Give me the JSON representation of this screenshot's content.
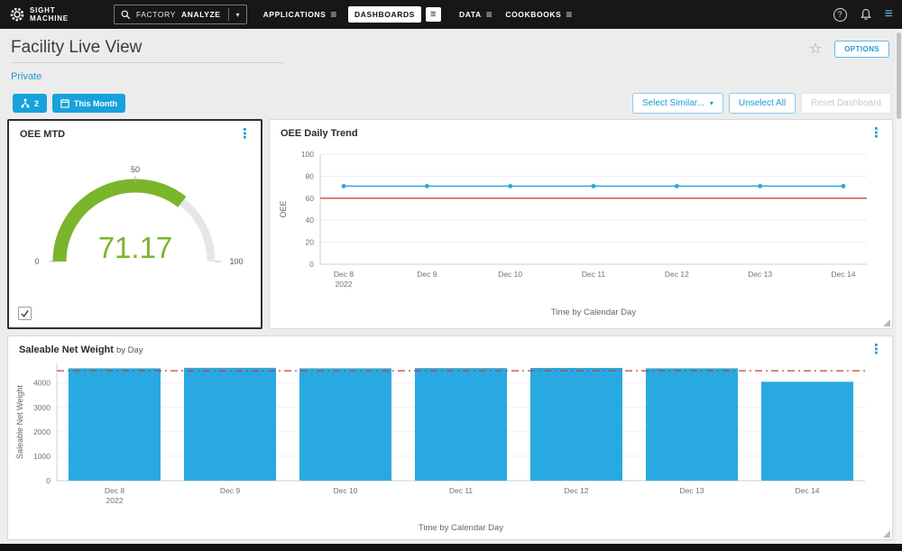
{
  "icons": {
    "caret_down": "▾",
    "kebab": "⋮",
    "hamburger": "≡",
    "star": "☆",
    "question": "?"
  },
  "navbar": {
    "brand_top": "SIGHT",
    "brand_bottom": "MACHINE",
    "factory": "FACTORY",
    "analyze": "ANALYZE",
    "applications": "APPLICATIONS",
    "dashboards": "DASHBOARDS",
    "data": "DATA",
    "cookbooks": "COOKBOOKS"
  },
  "header": {
    "title": "Facility Live View",
    "privacy": "Private",
    "options": "OPTIONS"
  },
  "toolbar": {
    "selected_count": "2",
    "time_filter": "This Month",
    "select_similar": "Select Similar...",
    "unselect_all": "Unselect All",
    "reset_dashboard": "Reset Dashboard"
  },
  "panels": {
    "gauge_title": "OEE MTD",
    "trend_title": "OEE Daily Trend",
    "bar_title": "Saleable Net Weight",
    "bar_subtitle": "by Day"
  },
  "chart_data": [
    {
      "type": "gauge",
      "title": "OEE MTD",
      "value": 71.17,
      "value_label": "71.17",
      "min": 0,
      "mid": 50,
      "max": 100,
      "arc_color": "#7ab52c",
      "track_color": "#e6e6e6"
    },
    {
      "type": "line",
      "title": "OEE Daily Trend",
      "categories": [
        "Dec 8",
        "Dec 9",
        "Dec 10",
        "Dec 11",
        "Dec 12",
        "Dec 13",
        "Dec 14"
      ],
      "first_category_sub": "2022",
      "values": [
        71,
        71,
        71,
        71,
        71,
        71,
        71
      ],
      "target": 60,
      "ylim": [
        0,
        100
      ],
      "yticks": [
        0,
        20,
        40,
        60,
        80,
        100
      ],
      "ylabel": "OEE",
      "xlabel": "Time by Calendar Day",
      "line_color": "#2ba7dd",
      "target_color": "#cb4a42",
      "grid": true,
      "legend": false
    },
    {
      "type": "bar",
      "title": "Saleable Net Weight by Day",
      "categories": [
        "Dec 8",
        "Dec 9",
        "Dec 10",
        "Dec 11",
        "Dec 12",
        "Dec 13",
        "Dec 14"
      ],
      "first_category_sub": "2022",
      "values": [
        4600,
        4620,
        4600,
        4610,
        4615,
        4600,
        4050
      ],
      "target": 4500,
      "ylim": [
        0,
        4800
      ],
      "yticks": [
        0,
        1000,
        2000,
        3000,
        4000
      ],
      "ylabel": "Saleable Net Weight",
      "xlabel": "Time by Calendar Day",
      "bar_color": "#29a9e1",
      "target_color": "#cc3b33",
      "grid": true,
      "legend": false
    }
  ]
}
